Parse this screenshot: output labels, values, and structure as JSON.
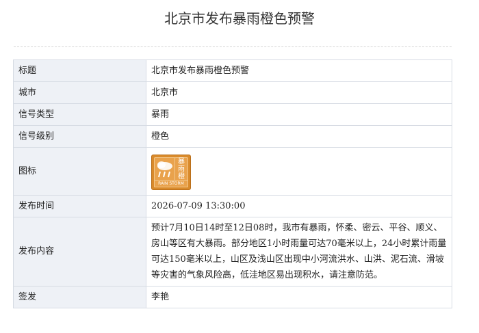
{
  "page_title": "北京市发布暴雨橙色预警",
  "rows": [
    {
      "label": "标题",
      "value": "北京市发布暴雨橙色预警"
    },
    {
      "label": "城市",
      "value": "北京市"
    },
    {
      "label": "信号类型",
      "value": "暴雨"
    },
    {
      "label": "信号级别",
      "value": "橙色"
    },
    {
      "label": "图标",
      "value": ""
    },
    {
      "label": "发布时间",
      "value": "2026-07-09 13:30:00"
    },
    {
      "label": "发布内容",
      "value": "预计7月10日14时至12日08时，我市有暴雨，怀柔、密云、平谷、顺义、房山等区有大暴雨。部分地区1小时雨量可达70毫米以上，24小时累计雨量可达150毫米以上，山区及浅山区出现中小河流洪水、山洪、泥石流、滑坡等灾害的气象风险高，低洼地区易出现积水，请注意防范。"
    },
    {
      "label": "签发",
      "value": "李艳"
    }
  ],
  "icon": {
    "name": "rainstorm-orange-warning-icon",
    "text_top": "暴",
    "text_mid": "雨",
    "text_bottom_left": "橙",
    "text_bottom": "RAIN STORM",
    "color": "#d98a2b"
  }
}
